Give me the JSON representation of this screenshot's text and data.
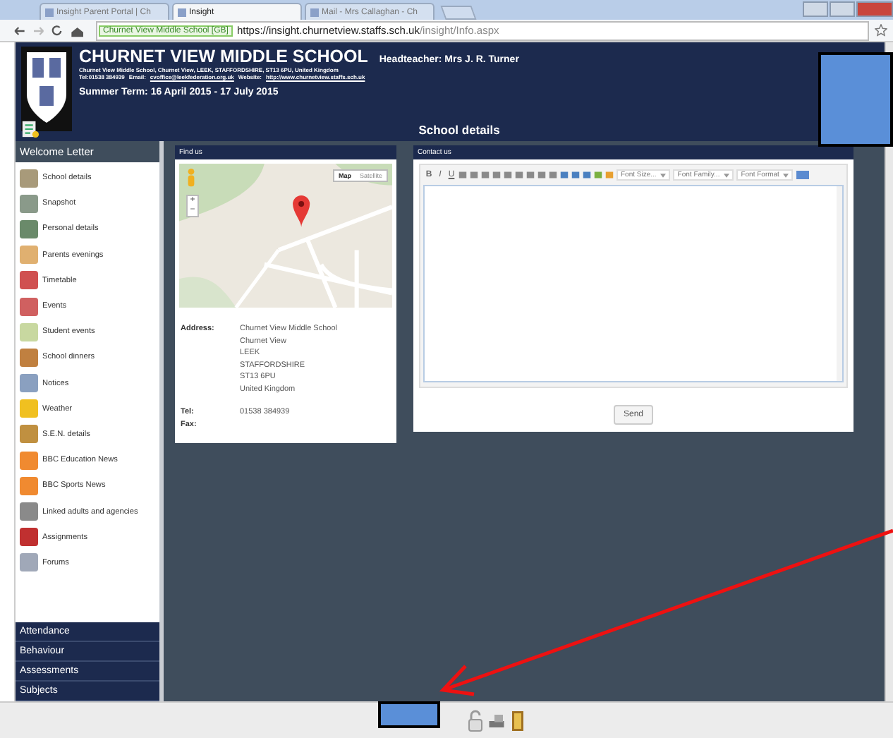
{
  "browser": {
    "tabs": [
      {
        "title": "Insight Parent Portal | Ch",
        "selected": false
      },
      {
        "title": "Insight",
        "selected": true
      },
      {
        "title": "Mail - Mrs Callaghan - Ch",
        "selected": false
      }
    ],
    "site_badge": "Churnet View Middle School [GB]",
    "url_host": "https://insight.churnetview.staffs.sch.uk",
    "url_path": "/insight/Info.aspx"
  },
  "header": {
    "school_name": "CHURNET VIEW MIDDLE SCHOOL",
    "headteacher": "Headteacher: Mrs J. R. Turner",
    "address_line": "Churnet View Middle School, Churnet View, LEEK, STAFFORDSHIRE, ST13 6PU, United Kingdom",
    "tel": "Tel:01538 384939",
    "email_label": "Email:",
    "email": "cvoffice@leekfederation.org.uk",
    "website_label": "Website:",
    "website": "http://www.churnetview.staffs.sch.uk",
    "term": "Summer Term: 16 April 2015 - 17 July 2015",
    "page_title": "School details"
  },
  "sidebar": {
    "heading": "Welcome Letter",
    "items": [
      "School details",
      "Snapshot",
      "Personal details",
      "Parents evenings",
      "Timetable",
      "Events",
      "Student events",
      "School dinners",
      "Notices",
      "Weather",
      "S.E.N. details",
      "BBC Education News",
      "BBC Sports News",
      "Linked adults and agencies",
      "Assignments",
      "Forums"
    ],
    "sections": [
      "Attendance",
      "Behaviour",
      "Assessments",
      "Subjects"
    ]
  },
  "find_us": {
    "title": "Find us",
    "map": {
      "kind": "picture",
      "map_types": [
        {
          "label": "Map",
          "selected": true
        },
        {
          "label": "Satellite",
          "selected": false
        }
      ],
      "zoom_in": "+",
      "zoom_out": "−"
    },
    "address_label": "Address:",
    "address_lines": [
      "Churnet View Middle School",
      "Churnet View",
      "LEEK",
      "STAFFORDSHIRE",
      "ST13 6PU",
      "United Kingdom"
    ],
    "tel_label": "Tel:",
    "tel": "01538 384939",
    "fax_label": "Fax:"
  },
  "contact_us": {
    "title": "Contact us",
    "format_buttons": [
      "B",
      "I",
      "U"
    ],
    "dropdowns": [
      "Font Size...",
      "Font Family...",
      "Font Format"
    ],
    "send": "Send"
  }
}
